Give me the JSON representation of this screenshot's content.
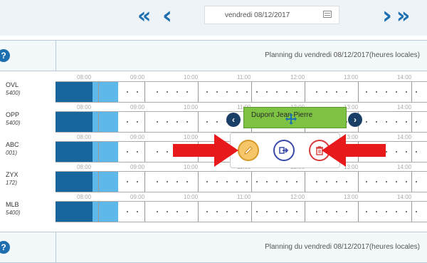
{
  "toolbar": {
    "prev_fast_icon": "«",
    "prev_icon": "‹",
    "next_icon": "›",
    "next_fast_icon": "»",
    "date_value": "vendredi 08/12/2017"
  },
  "header": {
    "help_label": "?",
    "title": "Planning du vendredi 08/12/2017(heures locales)"
  },
  "hours": [
    "08:00",
    "09:00",
    "10:00",
    "11:00",
    "12:00",
    "13:00",
    "14:00"
  ],
  "resources": [
    {
      "code": "OVL",
      "sub": "5400)"
    },
    {
      "code": "OPP",
      "sub": "5400)"
    },
    {
      "code": "ABC",
      "sub": "001)"
    },
    {
      "code": "ZYX",
      "sub": "172)"
    },
    {
      "code": "MLB",
      "sub": "5400)"
    }
  ],
  "event": {
    "label": "Dupont Jean Pierre"
  },
  "nav_circle": {
    "left": "‹",
    "right": "›"
  },
  "tools": {
    "edit_icon": "pencil-icon",
    "export_icon": "export-arrow-icon",
    "delete_icon": "trash-icon"
  },
  "footer": {
    "help_label": "?",
    "title": "Planning du vendredi 08/12/2017(heures locales)"
  },
  "colors": {
    "accent": "#1e6fb0",
    "booked_dark": "#17669e",
    "booked_light": "#5eb8ea",
    "event_green": "#7dc242",
    "annotation_red": "#e8191b"
  }
}
